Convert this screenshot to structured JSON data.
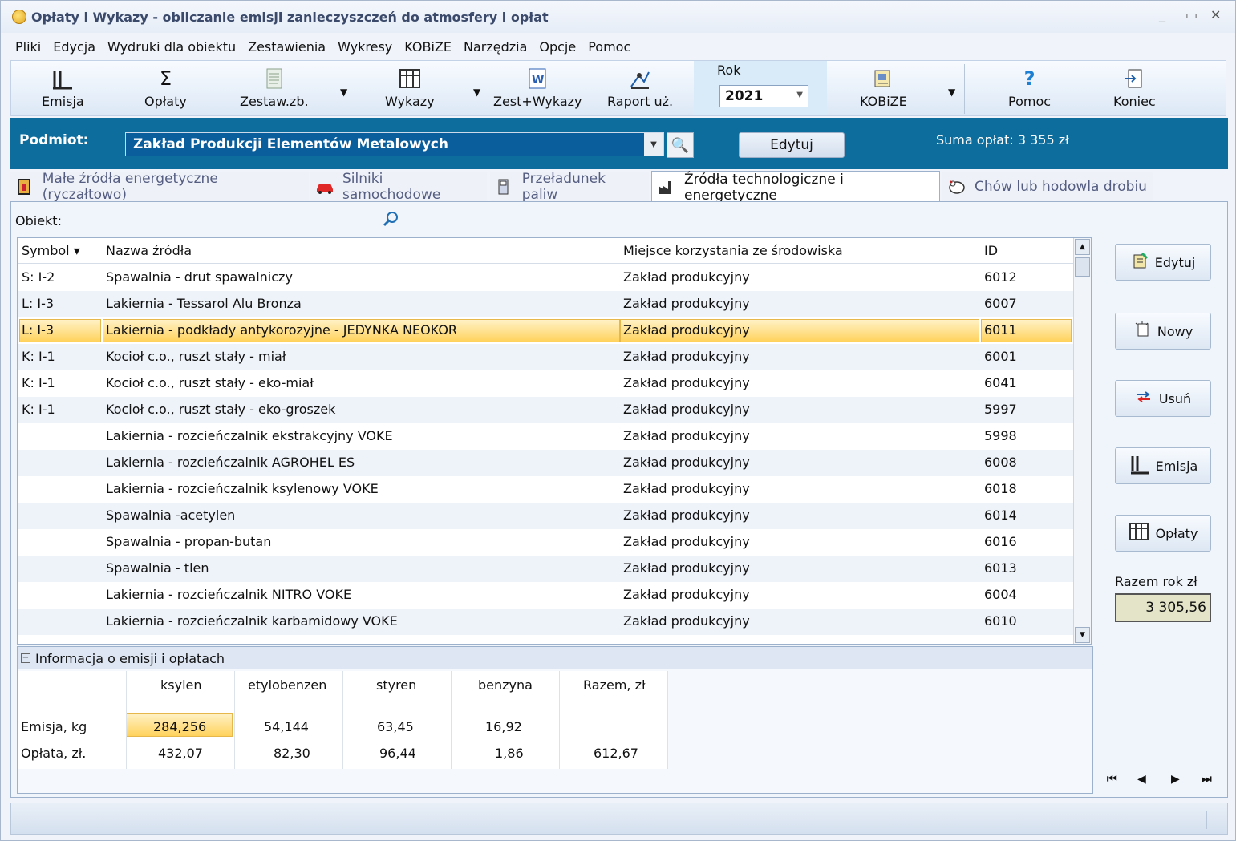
{
  "window": {
    "title": "Opłaty i Wykazy  - obliczanie emisji zanieczyszczeń do atmosfery i opłat",
    "controls": [
      "_",
      "▭",
      "✕"
    ]
  },
  "menu": [
    "Pliki",
    "Edycja",
    "Wydruki dla obiektu",
    "Zestawienia",
    "Wykresy",
    "KOBiZE",
    "Narzędzia",
    "Opcje",
    "Pomoc"
  ],
  "toolbar": {
    "emisja": "Emisja",
    "oplaty": "Opłaty",
    "zestaw": "Zestaw.zb.",
    "wykazy": "Wykazy",
    "zestwykazy": "Zest+Wykazy",
    "raport": "Raport uż.",
    "rok_label": "Rok",
    "rok_value": "2021",
    "kobize": "KOBiZE",
    "pomoc": "Pomoc",
    "koniec": "Koniec"
  },
  "podmiot": {
    "label": "Podmiot:",
    "value": "Zakład Produkcji Elementów Metalowych",
    "edit_label": "Edytuj",
    "suma": "Suma opłat: 3 355 zł"
  },
  "tabs": [
    {
      "label": "Małe źródła energetyczne (ryczałtowo)",
      "icon": "boiler-icon"
    },
    {
      "label": "Silniki samochodowe",
      "icon": "car-icon"
    },
    {
      "label": "Przeładunek paliw",
      "icon": "fuel-pump-icon"
    },
    {
      "label": "Źródła technologiczne i energetyczne",
      "icon": "factory-icon"
    },
    {
      "label": "Chów lub hodowla drobiu",
      "icon": "poultry-icon"
    }
  ],
  "obiekt_label": "Obiekt:",
  "grid": {
    "headers": {
      "symbol": "Symbol ▾",
      "nazwa": "Nazwa źródła",
      "miejsce": "Miejsce  korzystania ze środowiska",
      "id": "ID"
    },
    "rows": [
      {
        "symbol": "S: I-2",
        "nazwa": "Spawalnia - drut spawalniczy",
        "miejsce": "Zakład produkcyjny",
        "id": "6012"
      },
      {
        "symbol": "L: I-3",
        "nazwa": "Lakiernia - Tessarol Alu Bronza",
        "miejsce": "Zakład produkcyjny",
        "id": "6007"
      },
      {
        "symbol": "L: I-3",
        "nazwa": "Lakiernia - podkłady antykorozyjne - JEDYNKA NEOKOR",
        "miejsce": "Zakład produkcyjny",
        "id": "6011",
        "selected": true
      },
      {
        "symbol": "K: I-1",
        "nazwa": "Kocioł c.o., ruszt stały - miał",
        "miejsce": "Zakład produkcyjny",
        "id": "6001"
      },
      {
        "symbol": "K: I-1",
        "nazwa": "Kocioł c.o., ruszt stały - eko-miał",
        "miejsce": "Zakład produkcyjny",
        "id": "6041"
      },
      {
        "symbol": "K: I-1",
        "nazwa": "Kocioł c.o., ruszt stały - eko-groszek",
        "miejsce": "Zakład produkcyjny",
        "id": "5997"
      },
      {
        "symbol": "",
        "nazwa": "Lakiernia - rozcieńczalnik ekstrakcyjny VOKE",
        "miejsce": "Zakład produkcyjny",
        "id": "5998"
      },
      {
        "symbol": "",
        "nazwa": "Lakiernia - rozcieńczalnik AGROHEL ES",
        "miejsce": "Zakład produkcyjny",
        "id": "6008"
      },
      {
        "symbol": "",
        "nazwa": "Lakiernia - rozcieńczalnik ksylenowy VOKE",
        "miejsce": "Zakład produkcyjny",
        "id": "6018"
      },
      {
        "symbol": "",
        "nazwa": "Spawalnia -acetylen",
        "miejsce": "Zakład produkcyjny",
        "id": "6014"
      },
      {
        "symbol": "",
        "nazwa": "Spawalnia - propan-butan",
        "miejsce": "Zakład produkcyjny",
        "id": "6016"
      },
      {
        "symbol": "",
        "nazwa": "Spawalnia - tlen",
        "miejsce": "Zakład produkcyjny",
        "id": "6013"
      },
      {
        "symbol": "",
        "nazwa": "Lakiernia - rozcieńczalnik NITRO VOKE",
        "miejsce": "Zakład produkcyjny",
        "id": "6004"
      },
      {
        "symbol": "",
        "nazwa": "Lakiernia - rozcieńczalnik karbamidowy VOKE",
        "miejsce": "Zakład produkcyjny",
        "id": "6010"
      }
    ]
  },
  "info": {
    "title": "Informacja o emisji i opłatach",
    "columns": [
      "ksylen",
      "etylobenzen",
      "styren",
      "benzyna",
      "Razem, zł"
    ],
    "emisja_label": "Emisja, kg",
    "emisja": [
      "284,256",
      "54,144",
      "63,45",
      "16,92",
      ""
    ],
    "oplata_label": "Opłata, zł.",
    "oplata": [
      "432,07",
      "82,30",
      "96,44",
      "1,86",
      "612,67"
    ]
  },
  "side": {
    "edytuj": "Edytuj",
    "nowy": "Nowy",
    "usun": "Usuń",
    "emisja": "Emisja",
    "oplaty": "Opłaty",
    "razem_label": "Razem rok zł",
    "razem_value": "3 305,56"
  },
  "nav": [
    "⏮",
    "◀",
    "▶",
    "⏭"
  ]
}
